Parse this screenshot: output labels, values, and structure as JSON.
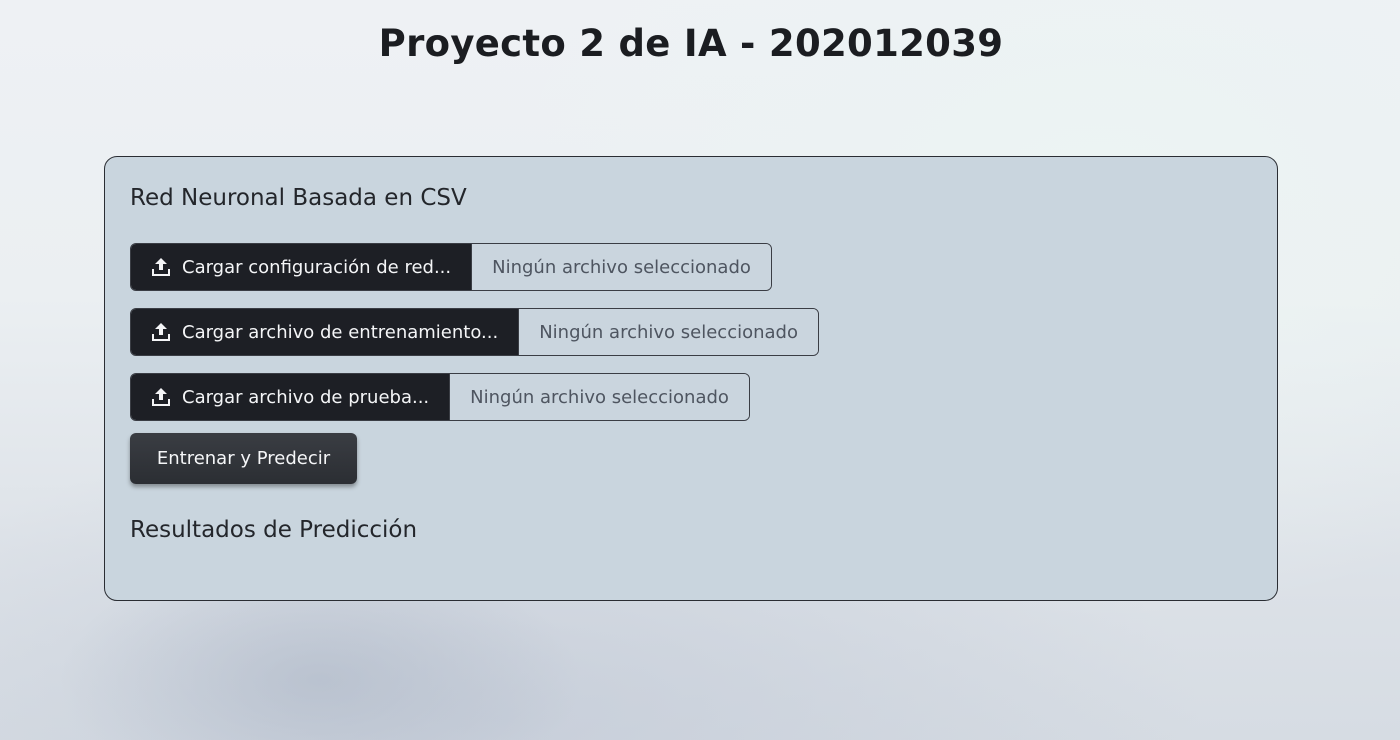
{
  "header": {
    "title": "Proyecto 2 de IA - 202012039"
  },
  "card": {
    "title": "Red Neuronal Basada en CSV",
    "uploads": [
      {
        "label": "Cargar configuración de red...",
        "status": "Ningún archivo seleccionado",
        "icon": "upload-icon"
      },
      {
        "label": "Cargar archivo de entrenamiento...",
        "status": "Ningún archivo seleccionado",
        "icon": "upload-icon"
      },
      {
        "label": "Cargar archivo de prueba...",
        "status": "Ningún archivo seleccionado",
        "icon": "upload-icon"
      }
    ],
    "train_button": "Entrenar y Predecir",
    "results_title": "Resultados de Predicción"
  }
}
